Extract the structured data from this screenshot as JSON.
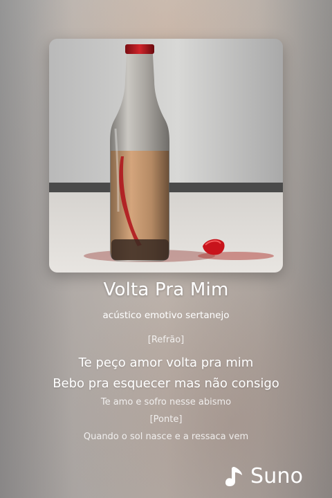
{
  "song": {
    "title": "Volta Pra Mim",
    "style": "acústico emotivo sertanejo"
  },
  "lyrics": [
    {
      "text": "[Refrão]",
      "kind": "section"
    },
    {
      "text": "Te peço amor volta pra mim",
      "kind": "active"
    },
    {
      "text": "Bebo pra esquecer mas não consigo",
      "kind": "active"
    },
    {
      "text": "Te amo e sofro nesse abismo",
      "kind": "faint"
    },
    {
      "text": "[Ponte]",
      "kind": "section"
    },
    {
      "text": "Quando o sol nasce e a ressaca vem",
      "kind": "faint"
    }
  ],
  "branding": {
    "logo_text": "Suno",
    "logo_icon": "suno-logo-icon"
  },
  "colors": {
    "text": "#ffffff",
    "wine": "#b0181e"
  }
}
